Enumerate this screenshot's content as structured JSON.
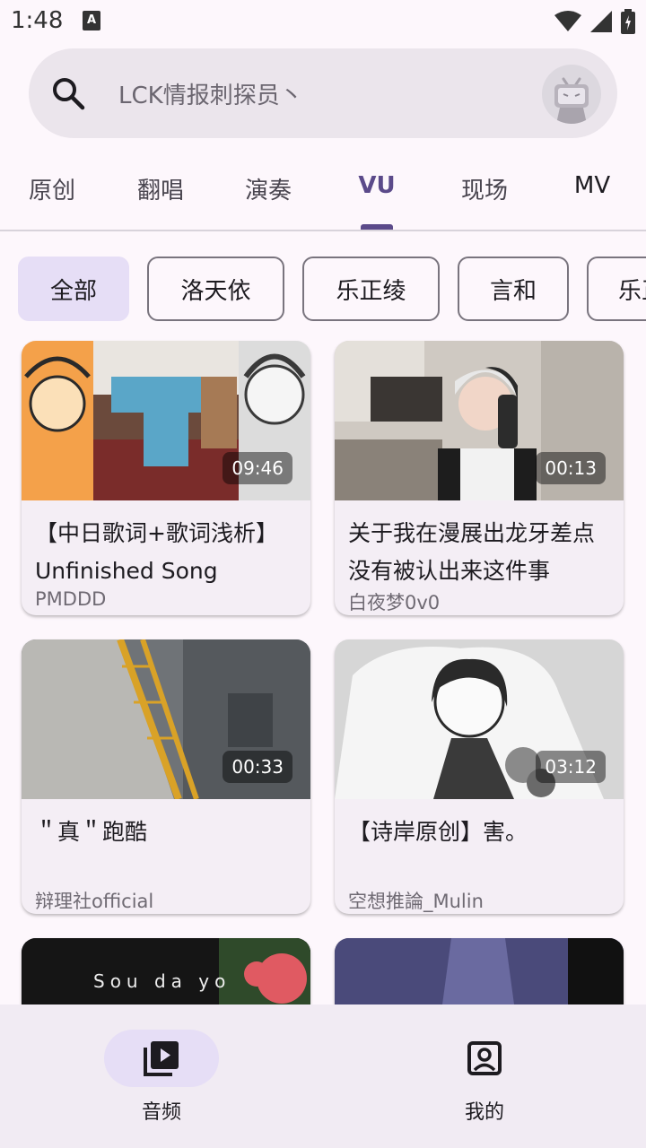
{
  "status": {
    "time": "1:48",
    "notification_glyph": "A"
  },
  "search": {
    "placeholder": "LCK情报刺探员丶"
  },
  "tabs": [
    {
      "label": "原创"
    },
    {
      "label": "翻唱"
    },
    {
      "label": "演奏"
    },
    {
      "label": "VU"
    },
    {
      "label": "现场"
    },
    {
      "label": "MV"
    }
  ],
  "active_tab": "VU",
  "chips": [
    {
      "label": "全部"
    },
    {
      "label": "洛天依"
    },
    {
      "label": "乐正绫"
    },
    {
      "label": "言和"
    },
    {
      "label": "乐正龙牙"
    }
  ],
  "cards": [
    {
      "title": "【中日歌词+歌词浅析】Unfinished Song",
      "author": "PMDDD",
      "duration": "09:46"
    },
    {
      "title": "关于我在漫展出龙牙差点没有被认出来这件事",
      "author": "白夜梦0v0",
      "duration": "00:13"
    },
    {
      "title": "＂真＂跑酷",
      "author": "辩理社official",
      "duration": "00:33"
    },
    {
      "title": "【诗岸原创】害。",
      "author": "空想推論_Mulin",
      "duration": "03:12"
    }
  ],
  "partial_card_caption": "Sou da yo",
  "bottom_nav": [
    {
      "label": "音频",
      "icon": "video-library-icon",
      "active": true
    },
    {
      "label": "我的",
      "icon": "account-box-icon",
      "active": false
    }
  ],
  "colors": {
    "accent": "#5b4a8a",
    "chip_selected": "#e6def6",
    "background": "#fdf7fc"
  }
}
